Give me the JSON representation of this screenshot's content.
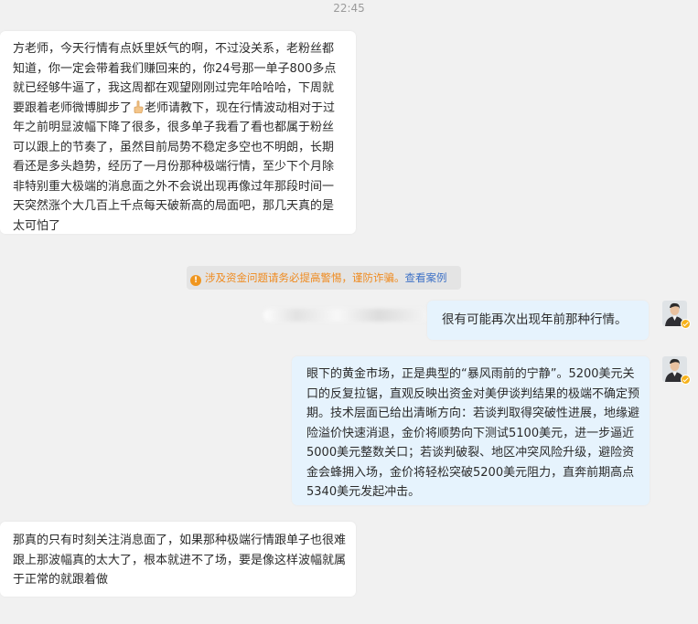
{
  "chat": {
    "timestamp": "22:45",
    "messages": [
      {
        "side": "incoming",
        "text_before_emoji": "方老师，今天行情有点妖里妖气的啊，不过没关系，老粉丝都知道，你一定会带着我们赚回来的，你24号那一单子800多点就已经够牛逼了，我这周都在观望刚刚过完年哈哈哈，下周就要跟着老师微博脚步了",
        "emoji": "pointing-up-emoji",
        "text_after_emoji": "老师请教下，现在行情波动相对于过年之前明显波幅下降了很多，很多单子我看了看也都属于粉丝可以跟上的节奏了，虽然目前局势不稳定多空也不明朗，长期看还是多头趋势，经历了一月份那种极端行情，至少下个月除非特别重大极端的消息面之外不会说出现再像过年那段时间一天突然涨个大几百上千点每天破新高的局面吧，那几天真的是太可怕了"
      },
      {
        "side": "outgoing",
        "text": "很有可能再次出现年前那种行情。"
      },
      {
        "side": "outgoing",
        "text": "眼下的黄金市场，正是典型的“暴风雨前的宁静”。5200美元关口的反复拉锯，直观反映出资金对美伊谈判结果的极端不确定预期。技术层面已给出清晰方向：若谈判取得突破性进展，地缘避险溢价快速消退，金价将顺势向下测试5100美元，进一步逼近5000美元整数关口；若谈判破裂、地区冲突风险升级，避险资金会蜂拥入场，金价将轻松突破5200美元阻力，直奔前期高点5340美元发起冲击。"
      },
      {
        "side": "incoming",
        "text": "那真的只有时刻关注消息面了，如果那种极端行情跟单子也很难跟上那波幅真的太大了，根本就进不了场，要是像这样波幅就属于正常的就跟着做"
      }
    ],
    "warning": {
      "icon": "warning-icon",
      "text": "涉及资金问题请务必提高警惕，谨防诈骗。",
      "link": "查看案例"
    }
  },
  "colors": {
    "background": "#f1f1f1",
    "incoming_bubble": "#ffffff",
    "outgoing_bubble": "#e6f3fd",
    "warning_text": "#ef8a1e",
    "warning_link": "#3f72c6",
    "verified_badge": "#f6b21a"
  }
}
